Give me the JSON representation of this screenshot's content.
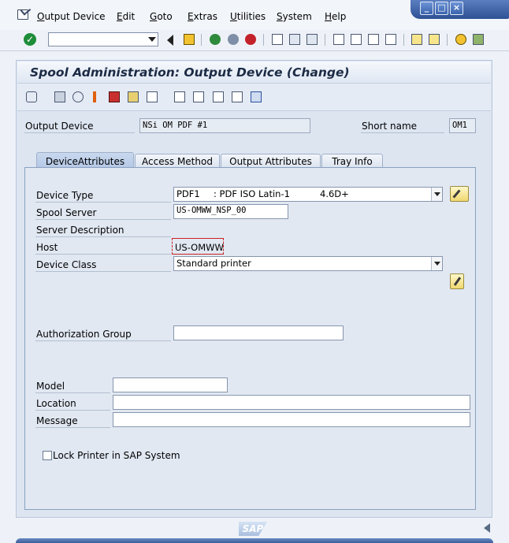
{
  "menu": {
    "items": [
      "Output Device",
      "Edit",
      "Goto",
      "Extras",
      "Utilities",
      "System",
      "Help"
    ]
  },
  "window_controls": {
    "minimize": "_",
    "maximize": "□",
    "close": "×"
  },
  "title": "Spool Administration: Output Device (Change)",
  "header": {
    "output_device_label": "Output Device",
    "output_device_value": "NSi OM PDF #1",
    "short_name_label": "Short name",
    "short_name_value": "OM1"
  },
  "tabs": [
    "DeviceAttributes",
    "Access Method",
    "Output Attributes",
    "Tray Info"
  ],
  "form": {
    "device_type_label": "Device Type",
    "device_type_code": "PDF1",
    "device_type_desc": ": PDF ISO Latin-1",
    "device_type_version": "4.6D+",
    "spool_server_label": "Spool Server",
    "spool_server_value": "US-OMWW_NSP_00",
    "server_description_label": "Server Description",
    "host_label": "Host",
    "host_value": "US-OMWW",
    "device_class_label": "Device Class",
    "device_class_value": "Standard printer",
    "authorization_group_label": "Authorization Group",
    "authorization_group_value": "",
    "model_label": "Model",
    "model_value": "",
    "location_label": "Location",
    "location_value": "",
    "message_label": "Message",
    "message_value": "",
    "lock_printer_label": "Lock Printer in SAP System"
  },
  "footer": {
    "logo": "SAP"
  },
  "colors": {
    "accent": "#2e5195",
    "panel": "#dde5f1"
  }
}
